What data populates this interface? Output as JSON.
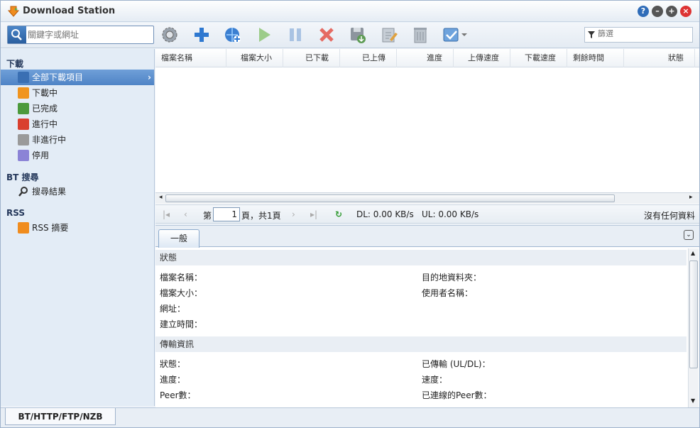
{
  "window": {
    "title": "Download Station"
  },
  "toolbar": {
    "search_placeholder": "關鍵字或網址",
    "filter_placeholder": "篩選"
  },
  "sidebar": {
    "download_header": "下載",
    "items": [
      {
        "label": "全部下載項目"
      },
      {
        "label": "下載中"
      },
      {
        "label": "已完成"
      },
      {
        "label": "進行中"
      },
      {
        "label": "非進行中"
      },
      {
        "label": "停用"
      }
    ],
    "bt_header": "BT 搜尋",
    "bt_items": [
      {
        "label": "搜尋結果"
      }
    ],
    "rss_header": "RSS",
    "rss_items": [
      {
        "label": "RSS 摘要"
      }
    ]
  },
  "grid": {
    "columns": [
      "檔案名稱",
      "檔案大小",
      "已下載",
      "已上傳",
      "進度",
      "上傳速度",
      "下載速度",
      "剩餘時間",
      "狀態"
    ]
  },
  "pager": {
    "page_prefix": "第",
    "page_value": "1",
    "page_suffix": "頁，共1頁",
    "dl": "DL: 0.00 KB/s",
    "ul": "UL: 0.00 KB/s",
    "status": "沒有任何資料"
  },
  "detail": {
    "tab": "一般",
    "status_header": "狀態",
    "file_name": "檔案名稱：",
    "dest_folder": "目的地資料夾：",
    "file_size": "檔案大小：",
    "username": "使用者名稱：",
    "url": "網址：",
    "created": "建立時間：",
    "transfer_header": "傳輸資訊",
    "status": "狀態：",
    "transferred": "已傳輸 (UL/DL)：",
    "progress": "進度：",
    "speed": "速度：",
    "peers": "Peer數：",
    "connected_peers": "已連線的Peer數："
  },
  "bottom": {
    "tab": "BT/HTTP/FTP/NZB"
  }
}
